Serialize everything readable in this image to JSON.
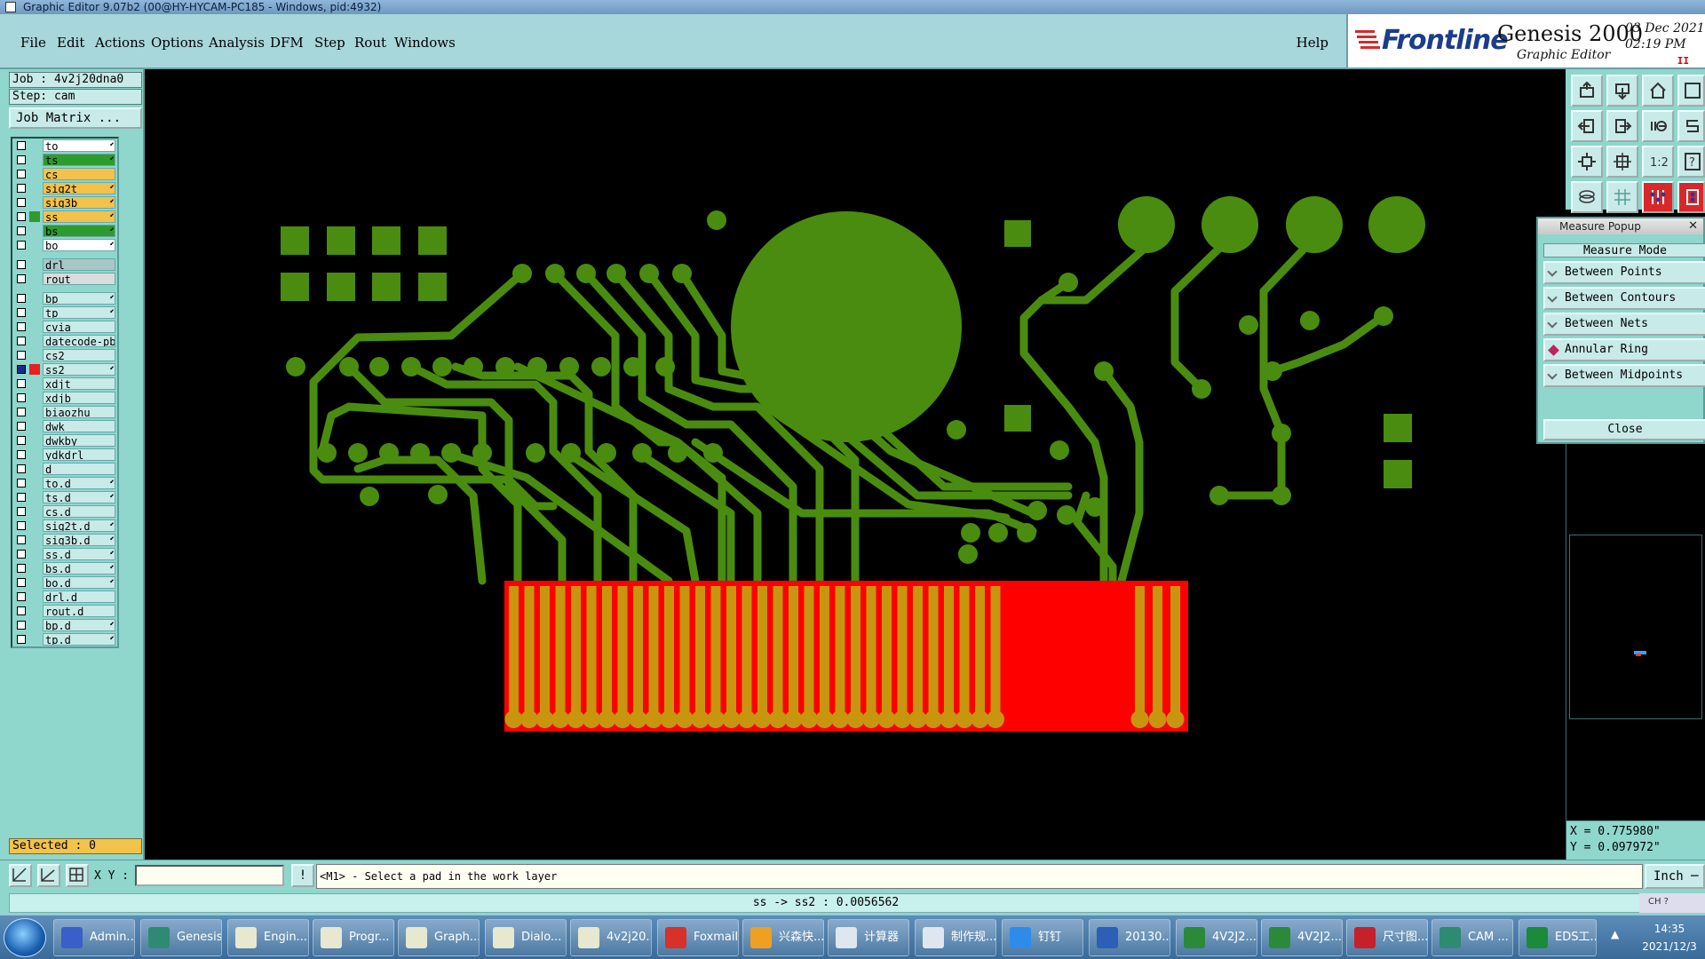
{
  "window": {
    "title": "Graphic Editor 9.07b2 (00@HY-HYCAM-PC185 - Windows, pid:4932)"
  },
  "menu": {
    "items": [
      "File",
      "Edit",
      "Actions",
      "Options",
      "Analysis",
      "DFM",
      "Step",
      "Rout",
      "Windows"
    ],
    "help": "Help"
  },
  "logo": {
    "brand": "Frontline",
    "product": "Genesis 2000",
    "subtitle": "Graphic Editor",
    "date": "03 Dec 2021",
    "time": "02:19 PM",
    "pause_mark": "II"
  },
  "job": {
    "job_label": "Job : 4v2j20dna0",
    "step_label": "Step: cam",
    "matrix_button": "Job Matrix ...",
    "selected": "Selected : 0"
  },
  "layers": [
    {
      "name": "to",
      "color": "#ffffff",
      "swatch": "",
      "arrow": "⬋"
    },
    {
      "name": "ts",
      "color": "#2e9b2e",
      "swatch": "",
      "arrow": "⬋"
    },
    {
      "name": "cs",
      "color": "#f3c24a",
      "swatch": "",
      "arrow": ""
    },
    {
      "name": "sig2t",
      "color": "#f3c24a",
      "swatch": "",
      "arrow": "⬋"
    },
    {
      "name": "sig3b",
      "color": "#f3c24a",
      "swatch": "",
      "arrow": "⬋"
    },
    {
      "name": "ss",
      "color": "#f3c24a",
      "swatch": "#2e9b2e",
      "arrow": "⬋"
    },
    {
      "name": "bs",
      "color": "#2e9b2e",
      "swatch": "",
      "arrow": "⬋"
    },
    {
      "name": "bo",
      "color": "#ffffff",
      "swatch": "",
      "arrow": "⬋"
    },
    {
      "gap": true
    },
    {
      "name": "drl",
      "color": "#a9c6c6",
      "swatch": "",
      "arrow": ""
    },
    {
      "name": "rout",
      "color": "#d8dcdc",
      "swatch": "",
      "arrow": ""
    },
    {
      "gap": true
    },
    {
      "name": "bp",
      "color": "#c8eae8",
      "swatch": "",
      "arrow": "⬋"
    },
    {
      "name": "tp",
      "color": "#c8eae8",
      "swatch": "",
      "arrow": "⬋"
    },
    {
      "name": "cvia",
      "color": "#c8eae8",
      "swatch": "",
      "arrow": ""
    },
    {
      "name": "datecode-pb",
      "color": "#c8eae8",
      "swatch": "",
      "arrow": ""
    },
    {
      "name": "cs2",
      "color": "#c8eae8",
      "swatch": "",
      "arrow": ""
    },
    {
      "name": "ss2",
      "color": "#c8eae8",
      "swatch": "#e8201e",
      "arrow": "⬋",
      "chk": "#1a2a8a"
    },
    {
      "name": "xdjt",
      "color": "#c8eae8",
      "swatch": "",
      "arrow": ""
    },
    {
      "name": "xdjb",
      "color": "#c8eae8",
      "swatch": "",
      "arrow": ""
    },
    {
      "name": "biaozhu",
      "color": "#c8eae8",
      "swatch": "",
      "arrow": ""
    },
    {
      "name": "dwk",
      "color": "#c8eae8",
      "swatch": "",
      "arrow": ""
    },
    {
      "name": "dwkby",
      "color": "#c8eae8",
      "swatch": "",
      "arrow": ""
    },
    {
      "name": "ydkdrl",
      "color": "#c8eae8",
      "swatch": "",
      "arrow": ""
    },
    {
      "name": "d",
      "color": "#c8eae8",
      "swatch": "",
      "arrow": ""
    },
    {
      "name": "to.d",
      "color": "#c8eae8",
      "swatch": "",
      "arrow": "⬋"
    },
    {
      "name": "ts.d",
      "color": "#c8eae8",
      "swatch": "",
      "arrow": "⬋"
    },
    {
      "name": "cs.d",
      "color": "#c8eae8",
      "swatch": "",
      "arrow": ""
    },
    {
      "name": "sig2t.d",
      "color": "#c8eae8",
      "swatch": "",
      "arrow": "⬋"
    },
    {
      "name": "sig3b.d",
      "color": "#c8eae8",
      "swatch": "",
      "arrow": "⬋"
    },
    {
      "name": "ss.d",
      "color": "#c8eae8",
      "swatch": "",
      "arrow": "⬋"
    },
    {
      "name": "bs.d",
      "color": "#c8eae8",
      "swatch": "",
      "arrow": "⬋"
    },
    {
      "name": "bo.d",
      "color": "#c8eae8",
      "swatch": "",
      "arrow": "⬋"
    },
    {
      "name": "drl.d",
      "color": "#c8eae8",
      "swatch": "",
      "arrow": ""
    },
    {
      "name": "rout.d",
      "color": "#c8eae8",
      "swatch": "",
      "arrow": ""
    },
    {
      "name": "bp.d",
      "color": "#c8eae8",
      "swatch": "",
      "arrow": "⬋"
    },
    {
      "name": "tp.d",
      "color": "#c8eae8",
      "swatch": "",
      "arrow": "⬋"
    }
  ],
  "measure": {
    "title": "Measure Popup",
    "mode_label": "Measure Mode",
    "options": [
      "Between Points",
      "Between Contours",
      "Between Nets",
      "Annular Ring",
      "Between Midpoints"
    ],
    "selected_option": "Annular Ring",
    "close": "Close"
  },
  "coords": {
    "x": "X = 0.775980\"",
    "y": "Y = 0.097972\""
  },
  "command": {
    "xy_label": "X Y :",
    "xy_value": "",
    "prompt": "<M1> - Select a pad in the work layer",
    "unit": "Inch ─"
  },
  "status": {
    "text": "ss -> ss2 : 0.0056562",
    "lang": "CH ?"
  },
  "taskbar": {
    "items": [
      {
        "label": "Admin...",
        "icon": "disk-icon",
        "color": "#3a5fc8"
      },
      {
        "label": "Genesis",
        "icon": "genesis-eye-icon",
        "color": "#2e8a70"
      },
      {
        "label": "Engin...",
        "icon": "x-window-icon",
        "color": "#e8e8d0"
      },
      {
        "label": "Progr...",
        "icon": "x-window-icon",
        "color": "#e8e8d0"
      },
      {
        "label": "Graph...",
        "icon": "x-window-icon",
        "color": "#e8e8d0"
      },
      {
        "label": "Dialo...",
        "icon": "x-window-icon",
        "color": "#e8e8d0"
      },
      {
        "label": "4v2j20...",
        "icon": "x-window-icon",
        "color": "#e8e8d0"
      },
      {
        "label": "Foxmail",
        "icon": "foxmail-icon",
        "color": "#d8302a"
      },
      {
        "label": "兴森快...",
        "icon": "flower-icon",
        "color": "#f0a020"
      },
      {
        "label": "计算器",
        "icon": "calculator-icon",
        "color": "#dfe6ee"
      },
      {
        "label": "制作规...",
        "icon": "document-icon",
        "color": "#e0e6f0"
      },
      {
        "label": "钉钉",
        "icon": "dingtalk-icon",
        "color": "#2f8bea"
      },
      {
        "label": "20130...",
        "icon": "word-icon",
        "color": "#2b5fb8"
      },
      {
        "label": "4V2J2...",
        "icon": "excel-icon",
        "color": "#2a8a3a"
      },
      {
        "label": "4V2J2...",
        "icon": "excel-icon",
        "color": "#2a8a3a"
      },
      {
        "label": "尺寸图...",
        "icon": "pdf-icon",
        "color": "#c8202a"
      },
      {
        "label": "CAM ...",
        "icon": "genesis-eye-icon",
        "color": "#2e8a70"
      },
      {
        "label": "EDS工...",
        "icon": "frontline-f-icon",
        "color": "#1b8a3a"
      }
    ],
    "clock_time": "14:35",
    "clock_date": "2021/12/3",
    "tray_arrow": "▲"
  },
  "colors": {
    "pcb_green": "#4a8c0f",
    "pad_gold": "#c8950e",
    "mask_red": "#ff0000",
    "panel": "#8fd6cc"
  }
}
